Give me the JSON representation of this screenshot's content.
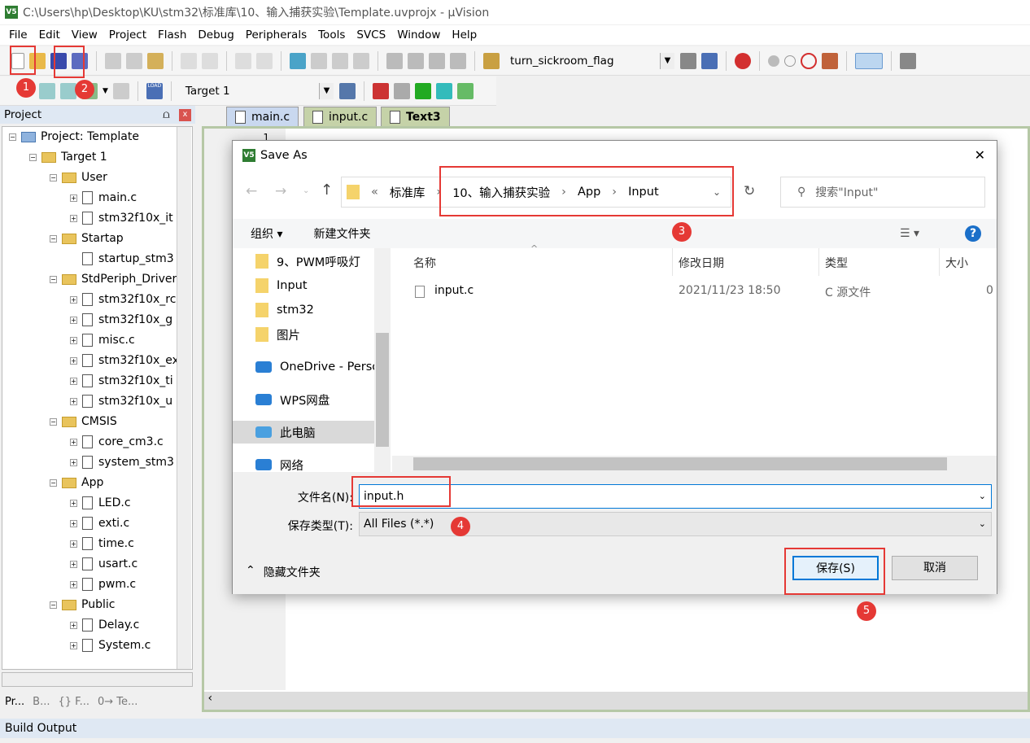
{
  "window": {
    "title": "C:\\Users\\hp\\Desktop\\KU\\stm32\\标准库\\10、输入捕获实验\\Template.uvprojx - µVision",
    "logo": "V5"
  },
  "menu": [
    "File",
    "Edit",
    "View",
    "Project",
    "Flash",
    "Debug",
    "Peripherals",
    "Tools",
    "SVCS",
    "Window",
    "Help"
  ],
  "toolbar": {
    "find_combo": "turn_sickroom_flag",
    "target_combo": "Target 1",
    "load_label": "LOAD"
  },
  "annotations": [
    "1",
    "2",
    "3",
    "4",
    "5"
  ],
  "project_panel": {
    "title": "Project",
    "pin": "⩍",
    "close": "x",
    "tree": [
      {
        "label": "Project: Template",
        "depth": 0,
        "kind": "project"
      },
      {
        "label": "Target 1",
        "depth": 1,
        "kind": "folder"
      },
      {
        "label": "User",
        "depth": 2,
        "kind": "folder"
      },
      {
        "label": "main.c",
        "depth": 3,
        "kind": "file",
        "expand": true
      },
      {
        "label": "stm32f10x_it",
        "depth": 3,
        "kind": "file",
        "expand": true
      },
      {
        "label": "Startap",
        "depth": 2,
        "kind": "folder"
      },
      {
        "label": "startup_stm3",
        "depth": 3,
        "kind": "file",
        "expand": false
      },
      {
        "label": "StdPeriph_Driver",
        "depth": 2,
        "kind": "folder"
      },
      {
        "label": "stm32f10x_rc",
        "depth": 3,
        "kind": "file",
        "expand": true
      },
      {
        "label": "stm32f10x_g",
        "depth": 3,
        "kind": "file",
        "expand": true
      },
      {
        "label": "misc.c",
        "depth": 3,
        "kind": "file",
        "expand": true
      },
      {
        "label": "stm32f10x_ex",
        "depth": 3,
        "kind": "file",
        "expand": true
      },
      {
        "label": "stm32f10x_ti",
        "depth": 3,
        "kind": "file",
        "expand": true
      },
      {
        "label": "stm32f10x_u",
        "depth": 3,
        "kind": "file",
        "expand": true
      },
      {
        "label": "CMSIS",
        "depth": 2,
        "kind": "folder"
      },
      {
        "label": "core_cm3.c",
        "depth": 3,
        "kind": "file",
        "expand": true
      },
      {
        "label": "system_stm3",
        "depth": 3,
        "kind": "file",
        "expand": true
      },
      {
        "label": "App",
        "depth": 2,
        "kind": "folder"
      },
      {
        "label": "LED.c",
        "depth": 3,
        "kind": "file",
        "expand": true
      },
      {
        "label": "exti.c",
        "depth": 3,
        "kind": "file",
        "expand": true
      },
      {
        "label": "time.c",
        "depth": 3,
        "kind": "file",
        "expand": true
      },
      {
        "label": "usart.c",
        "depth": 3,
        "kind": "file",
        "expand": true
      },
      {
        "label": "pwm.c",
        "depth": 3,
        "kind": "file",
        "expand": true
      },
      {
        "label": "Public",
        "depth": 2,
        "kind": "folder"
      },
      {
        "label": "Delay.c",
        "depth": 3,
        "kind": "file",
        "expand": true
      },
      {
        "label": "System.c",
        "depth": 3,
        "kind": "file",
        "expand": true
      }
    ],
    "bottom_tabs": [
      "Pr...",
      "B...",
      "{} F...",
      "0→ Te..."
    ]
  },
  "editor": {
    "tabs": [
      "main.c",
      "input.c",
      "Text3"
    ],
    "line_number": "1"
  },
  "build_output": {
    "title": "Build Output"
  },
  "dialog": {
    "title": "Save As",
    "close": "✕",
    "breadcrumb": [
      "«",
      "标准库",
      "›",
      "10、输入捕获实验",
      "›",
      "App",
      "›",
      "Input"
    ],
    "search_placeholder": "搜索\"Input\"",
    "organize": "组织 ▾",
    "new_folder": "新建文件夹",
    "help": "?",
    "nav_items": [
      "9、PWM呼吸灯",
      "Input",
      "stm32",
      "图片",
      "OneDrive - Perso",
      "WPS网盘",
      "此电脑",
      "网络"
    ],
    "columns": [
      "名称",
      "修改日期",
      "类型",
      "大小"
    ],
    "files": [
      {
        "name": "input.c",
        "modified": "2021/11/23 18:50",
        "type": "C 源文件",
        "size": "0"
      }
    ],
    "filename_label": "文件名(N):",
    "filename_value": "input.h",
    "filetype_label": "保存类型(T):",
    "filetype_value": "All Files (*.*)",
    "hide_folders": "隐藏文件夹",
    "save": "保存(S)",
    "cancel": "取消"
  }
}
